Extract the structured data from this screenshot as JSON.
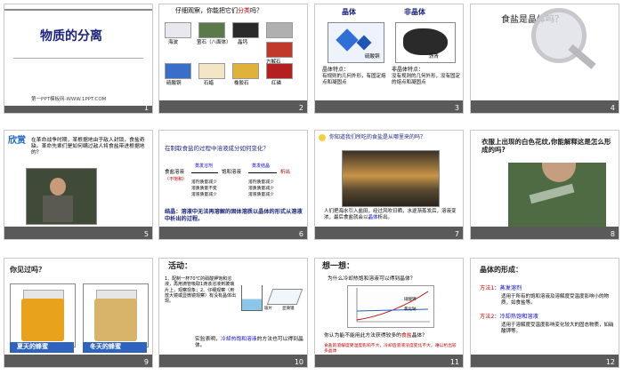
{
  "slides": [
    {
      "num": "1",
      "title": "物质的分离",
      "footer": "第一PPT模板网-WWW.1PPT.COM"
    },
    {
      "num": "2",
      "question_prefix": "仔细观察，你能把它们",
      "question_highlight": "分类",
      "question_suffix": "吗？",
      "items": [
        "海波",
        "萤石（八面体）",
        "晶钙",
        "",
        "方解石",
        "硫酸铜",
        "石蜡",
        "橡胶石",
        "红磷"
      ]
    },
    {
      "num": "3",
      "left_title": "晶体",
      "right_title": "非晶体",
      "photo_left_label": "硫酸铜",
      "photo_right_label": "沥青",
      "left_feature_title": "晶体特点：",
      "left_feature": "有规则的几何外形，有固定熔点和凝固点",
      "right_feature_title": "非晶体特点：",
      "right_feature": "没有规则的几何外形，没有固定的熔点和凝固点"
    },
    {
      "num": "4",
      "question": "食盐是晶体吗？"
    },
    {
      "num": "5",
      "heading": "欣赏",
      "text": "在革命战争时期，某根据地由于敌人封锁，食盐奇缺。革命先辈们是如何瞒过敌人将食盐带进根据地的？"
    },
    {
      "num": "6",
      "question": "在制取食盐的过程中溶液成分如何变化？",
      "stage1": "食盐溶液",
      "stage1_sub": "（不饱和）",
      "arrow1": "蒸发溶剂",
      "stage2": "饱和溶液",
      "arrow2": "蒸发结晶",
      "stage3": "析出",
      "rows": [
        "溶剂质量减少",
        "溶质质量不变",
        "溶液质量减少",
        "溶剂质量减少",
        "溶质质量减少",
        "溶液质量减少"
      ],
      "conclusion": "结晶：溶液中无法再溶解的固体溶质以晶体的形式从溶液中析出的过程。"
    },
    {
      "num": "7",
      "question": "你知道我们所吃的食盐是从哪里来的吗？",
      "caption_prefix": "人们把海水引入盐田，经过风吹日晒，水逐渐蒸发后，溶液变浓，最后食盐就会以",
      "caption_highlight": "晶体",
      "caption_suffix": "析出。"
    },
    {
      "num": "8",
      "question": "衣服上出现的白色花纹,你能解释这是怎么形成的吗?"
    },
    {
      "num": "9",
      "question": "你见过吗？",
      "left_label": "夏天的蜂蜜",
      "right_label": "冬天的蜂蜜"
    },
    {
      "num": "10",
      "heading": "活动：",
      "steps": "1、配制一杯70℃的硝酸钾饱和溶液，再用滴管吸取1滴该溶液到玻璃片上，观察现象；2、仔细观察（用放大镜或显微镜观察）有没有晶体出现。",
      "fig_label": "玻片",
      "fig_label2": "显微镜",
      "conclusion_prefix": "实验表明，",
      "conclusion_highlight": "冷却热饱和溶液",
      "conclusion_suffix": "的方法也可以得到晶体。"
    },
    {
      "num": "11",
      "heading": "想一想：",
      "question": "为什么冷却热饱和溶液可以得到晶体？",
      "chart_legend": [
        "硝酸钾",
        "氯化钠"
      ],
      "q2_prefix": "你认为能不能用此方法获得较多的",
      "q2_highlight": "食盐",
      "q2_suffix": "晶体？",
      "answer": "食盐的溶解度受温度影响不大，冷却后溶液浓度变化不大，难以析出较多晶体"
    },
    {
      "num": "12",
      "heading": "晶体的形成：",
      "method1_label": "方法1：",
      "method1": "蒸发溶剂",
      "method1_desc": "适用于所有的饱和溶液及溶解度受温度影响小的物质，如食盐等。",
      "method2_label": "方法2：",
      "method2": "冷却热饱和溶液",
      "method2_desc": "适用于溶解度受温度影响变化较大的固态物质，如硝酸钾等。"
    }
  ],
  "colors": {
    "accent_blue": "#1565c0",
    "accent_red": "#c00000",
    "footer_bar": "#5a5a5a"
  }
}
